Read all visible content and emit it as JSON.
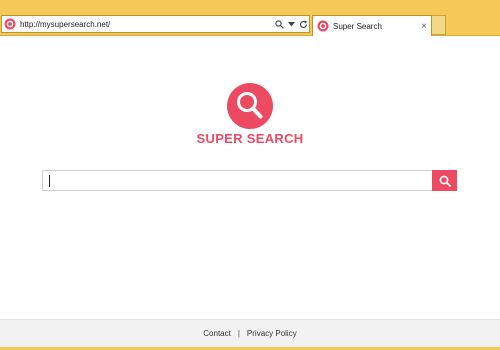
{
  "browser": {
    "address_url": "http://mysupersearch.net/",
    "tab_title": "Super Search",
    "tab_close": "×",
    "icons": [
      "site-icon",
      "search-icon",
      "dropdown-arrow-icon",
      "refresh-icon",
      "close-icon"
    ]
  },
  "page": {
    "brand": "SUPER SEARCH",
    "search_value": "",
    "footer": {
      "contact": "Contact",
      "separator": "|",
      "privacy": "Privacy Policy"
    }
  },
  "colors": {
    "accent": "#ec4a62",
    "chrome": "#f5c957"
  }
}
